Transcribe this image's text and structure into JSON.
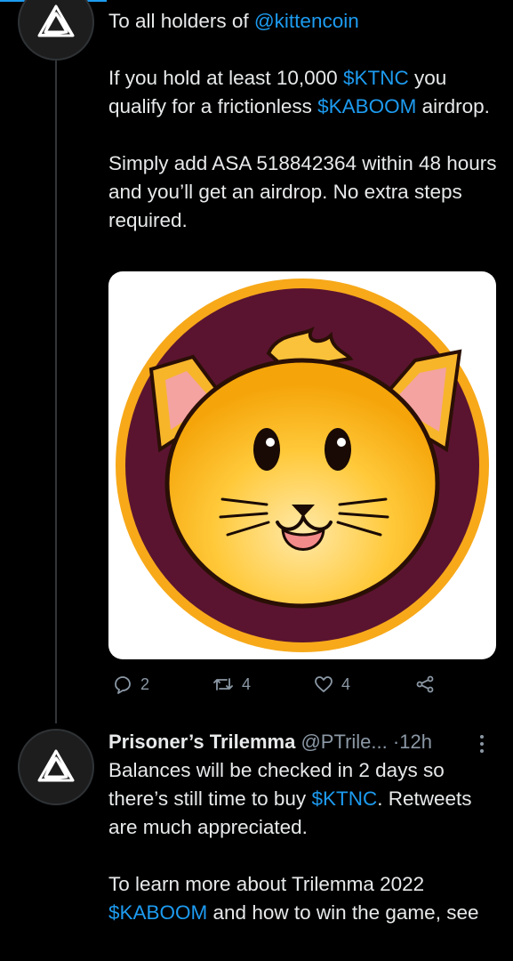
{
  "tweet1": {
    "line1_prefix": "To all holders of ",
    "line1_link": "@kittencoin",
    "p2_a": "If you hold at least 10,000 ",
    "p2_link1": "$KTNC",
    "p2_b": " you qualify for a frictionless ",
    "p2_link2": "$KABOOM",
    "p2_c": " airdrop.",
    "p3": "Simply add ASA 518842364 within 48 hours and you’ll get an airdrop. No extra steps required."
  },
  "actions": {
    "reply_count": "2",
    "retweet_count": "4",
    "like_count": "4"
  },
  "tweet2": {
    "name": "Prisoner’s Trilemma",
    "handle": "@PTrile...",
    "separator": "·",
    "time": "12h",
    "p1_a": "Balances will be checked in 2 days so there’s still time to buy ",
    "p1_link": "$KTNC",
    "p1_b": ". Retweets are much appreciated.",
    "p2_a": "To learn more about Trilemma 2022 ",
    "p2_link": "$KABOOM",
    "p2_b": " and how to win the game, see"
  },
  "colors": {
    "link": "#1d9bf0",
    "background": "#000000",
    "secondary_text": "#8b98a5"
  }
}
